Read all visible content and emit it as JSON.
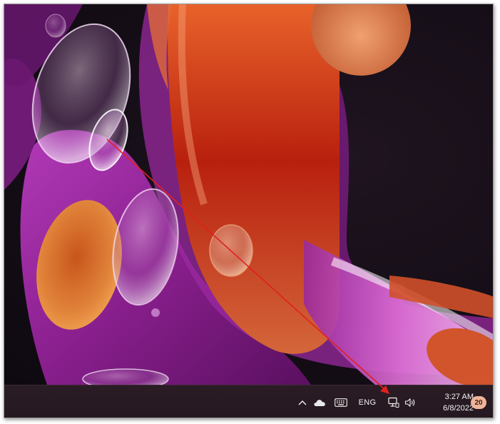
{
  "desktop": {
    "wallpaper": "abstract-bloom-wallpaper"
  },
  "taskbar": {
    "show_hidden_icon": "chevron-up-icon",
    "onedrive_icon": "cloud-icon",
    "keyboard_icon": "keyboard-icon",
    "language": "ENG",
    "network_icon": "network-icon",
    "volume_icon": "speaker-icon",
    "clock": {
      "time": "3:27 AM",
      "date": "6/8/2022"
    },
    "notification_count": "20",
    "notification_badge_color": "#f0b49a"
  },
  "annotation": {
    "arrow_color": "#e02020",
    "points_to": "network-icon"
  }
}
